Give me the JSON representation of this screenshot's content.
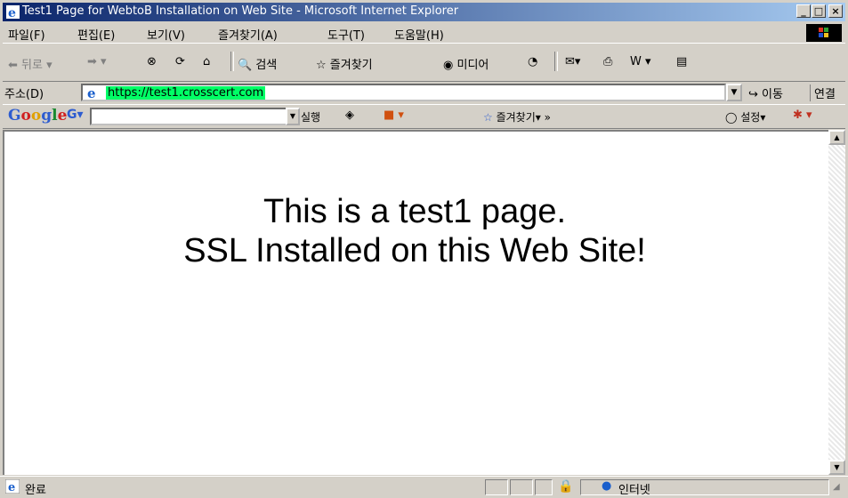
{
  "window": {
    "title": "Test1 Page for WebtoB Installation on Web Site - Microsoft Internet Explorer",
    "min": "_",
    "max": "□",
    "close": "×"
  },
  "menu": [
    "파일(F)",
    "편집(E)",
    "보기(V)",
    "즐겨찾기(A)",
    "도구(T)",
    "도움말(H)"
  ],
  "toolbar": {
    "back": "뒤로",
    "search": "검색",
    "favorites": "즐겨찾기",
    "media": "미디어"
  },
  "address": {
    "label": "주소(D)",
    "url": "https://test1.crosscert.com",
    "go": "이동",
    "links": "연결"
  },
  "google": {
    "logo": [
      "G",
      "o",
      "o",
      "g",
      "l",
      "e"
    ],
    "run": "실행",
    "favorites": "즐겨찾기",
    "settings": "설정"
  },
  "page": {
    "line1": "This is a test1 page.",
    "line2": "SSL Installed on this Web Site!"
  },
  "status": {
    "text": "완료",
    "zone": "인터넷"
  },
  "colors": {
    "title_start": "#0a246a",
    "title_end": "#a6caf0",
    "url_highlight": "#00ff66"
  }
}
